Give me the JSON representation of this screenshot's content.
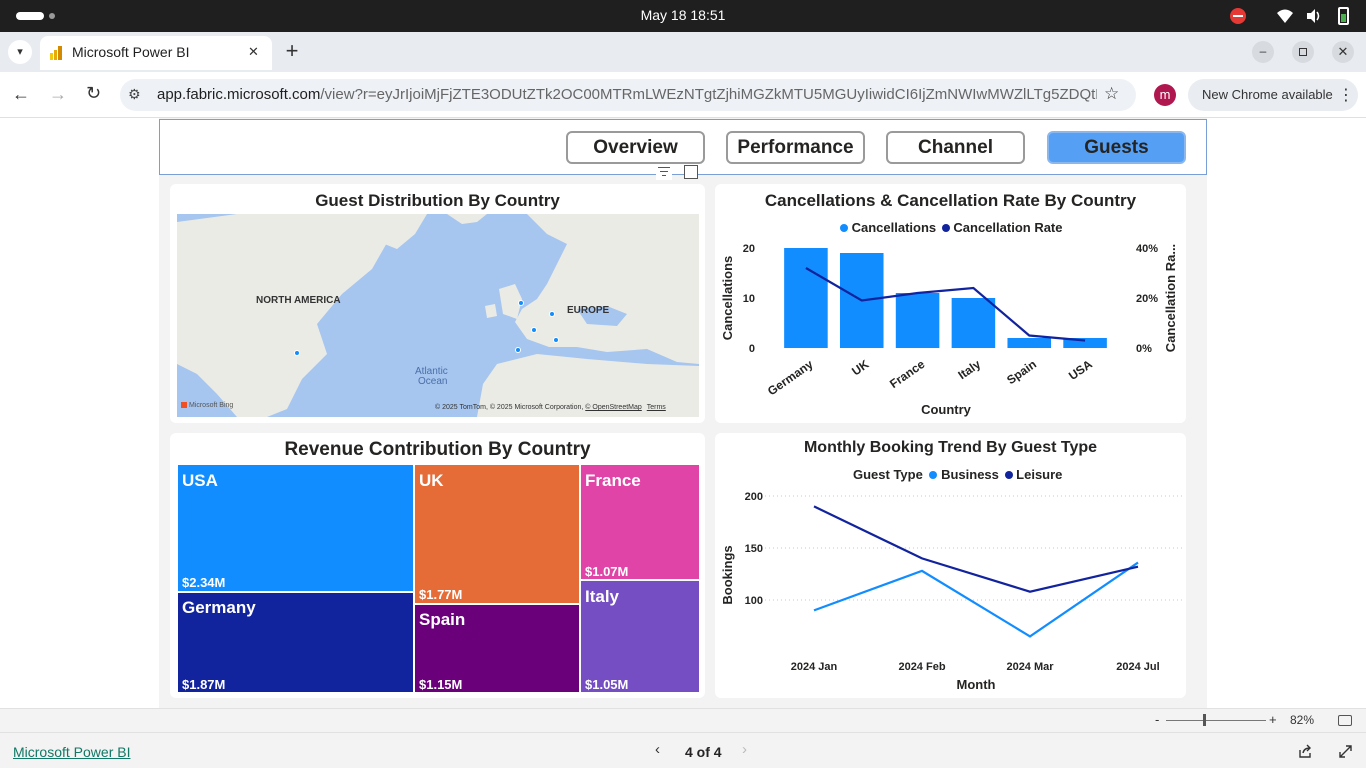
{
  "os": {
    "clock": "May 18  18:51"
  },
  "browser": {
    "tab_title": "Microsoft Power BI",
    "url_domain": "app.fabric.microsoft.com",
    "url_path": "/view?r=eyJrIjoiMjFjZTE3ODUtZTk2OC00MTRmLWEzNTgtZjhiMGZkMTU5MGUyIiwidCI6IjZmNWIwMWZlLTg5ZDQtNDk4Ny...",
    "profile_initial": "m",
    "update_label": "New Chrome available"
  },
  "nav": {
    "buttons": [
      "Overview",
      "Performance",
      "Channel",
      "Guests"
    ],
    "active": "Guests"
  },
  "map_card": {
    "title": "Guest Distribution By Country",
    "labels": {
      "north_america": "NORTH AMERICA",
      "europe": "EUROPE",
      "atlantic": "Atlantic",
      "ocean": "Ocean"
    },
    "logo": "Microsoft Bing",
    "copyright": "© 2025 TomTom, © 2025 Microsoft Corporation,",
    "osm_link": "© OpenStreetMap",
    "terms_link": "Terms"
  },
  "cancel_card": {
    "title": "Cancellations & Cancellation Rate By Country",
    "legend": [
      "Cancellations",
      "Cancellation Rate"
    ],
    "colors": {
      "bars": "#118dff",
      "line": "#12239e"
    }
  },
  "revenue_card": {
    "title": "Revenue Contribution By Country",
    "tiles": [
      {
        "name": "USA",
        "value": "$2.34M",
        "color": "#118dff"
      },
      {
        "name": "Germany",
        "value": "$1.87M",
        "color": "#12239e"
      },
      {
        "name": "UK",
        "value": "$1.77M",
        "color": "#e66c37"
      },
      {
        "name": "Spain",
        "value": "$1.15M",
        "color": "#6b007b"
      },
      {
        "name": "France",
        "value": "$1.07M",
        "color": "#e044a7"
      },
      {
        "name": "Italy",
        "value": "$1.05M",
        "color": "#744ec2"
      }
    ]
  },
  "trend_card": {
    "title": "Monthly Booking Trend By Guest Type",
    "legend_title": "Guest Type",
    "legend": [
      "Business",
      "Leisure"
    ],
    "colors": {
      "Business": "#118dff",
      "Leisure": "#12239e"
    }
  },
  "chart_data": [
    {
      "type": "bar",
      "title": "Cancellations & Cancellation Rate By Country",
      "categories": [
        "Germany",
        "UK",
        "France",
        "Italy",
        "Spain",
        "USA"
      ],
      "series": [
        {
          "name": "Cancellations",
          "type": "bar",
          "axis": "left",
          "values": [
            20,
            19,
            11,
            10,
            2,
            2
          ]
        },
        {
          "name": "Cancellation Rate",
          "type": "line",
          "axis": "right",
          "values": [
            32,
            19,
            22,
            24,
            5,
            3
          ]
        }
      ],
      "xlabel": "Country",
      "ylabel": "Cancellations",
      "y2label": "Cancellation Ra...",
      "ylim": [
        0,
        20
      ],
      "y2lim": [
        0,
        40
      ],
      "yticks": [
        "0",
        "10",
        "20"
      ],
      "y2ticks": [
        "0%",
        "20%",
        "40%"
      ],
      "legend": "top-center"
    },
    {
      "type": "line",
      "title": "Monthly Booking Trend By Guest Type",
      "categories": [
        "2024 Jan",
        "2024 Feb",
        "2024 Mar",
        "2024 Jul"
      ],
      "series": [
        {
          "name": "Business",
          "values": [
            90,
            128,
            65,
            136
          ]
        },
        {
          "name": "Leisure",
          "values": [
            190,
            140,
            108,
            132
          ]
        }
      ],
      "xlabel": "Month",
      "ylabel": "Bookings",
      "ylim": [
        50,
        200
      ],
      "yticks": [
        "100",
        "150",
        "200"
      ],
      "legend": "top-center",
      "grid": true
    },
    {
      "type": "table",
      "title": "Revenue Contribution By Country",
      "categories": [
        "USA",
        "Germany",
        "UK",
        "Spain",
        "France",
        "Italy"
      ],
      "values": [
        2.34,
        1.87,
        1.77,
        1.15,
        1.07,
        1.05
      ],
      "unit": "$M"
    }
  ],
  "footer": {
    "zoom": "82%",
    "zoom_minus": "-",
    "zoom_plus": "+",
    "brand_link": "Microsoft Power BI",
    "page_indicator": "4 of 4"
  }
}
